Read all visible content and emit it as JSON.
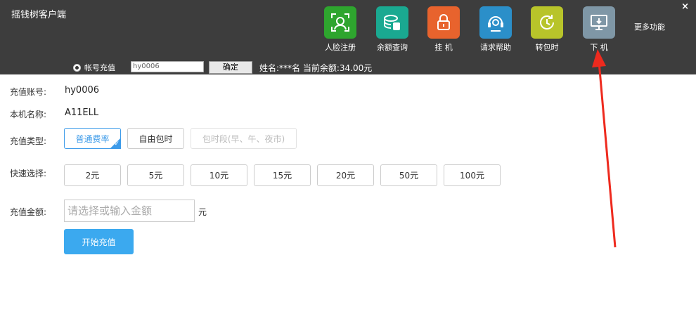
{
  "app": {
    "title": "摇钱树客户端",
    "close": "×"
  },
  "toolbar": {
    "items": [
      {
        "label": "人脸注册",
        "icon": "face-scan-icon",
        "color": "#2ea52e"
      },
      {
        "label": "余额查询",
        "icon": "coins-icon",
        "color": "#1aa991"
      },
      {
        "label": "挂 机",
        "icon": "lock-icon",
        "color": "#e8632d"
      },
      {
        "label": "请求帮助",
        "icon": "headset-icon",
        "color": "#2b8fc9"
      },
      {
        "label": "转包时",
        "icon": "refresh-clock-icon",
        "color": "#b8c42a"
      },
      {
        "label": "下 机",
        "icon": "monitor-icon",
        "color": "#7f97a6"
      }
    ],
    "more": "更多功能"
  },
  "account_bar": {
    "radio_label": "帐号充值",
    "account_value": "hy0006",
    "confirm": "确定",
    "info": "姓名:***名  当前余额:34.00元"
  },
  "form": {
    "account_label": "充值账号:",
    "account_value": "hy0006",
    "machine_label": "本机名称:",
    "machine_value": "A11ELL",
    "type_label": "充值类型:",
    "types": [
      "普通费率",
      "自由包时",
      "包时段(早、午、夜市)"
    ],
    "quick_label": "快速选择:",
    "quick": [
      "2元",
      "5元",
      "10元",
      "15元",
      "20元",
      "50元",
      "100元"
    ],
    "amount_label": "充值金额:",
    "amount_placeholder": "请选择或输入金额",
    "unit": "元",
    "start": "开始充值"
  }
}
